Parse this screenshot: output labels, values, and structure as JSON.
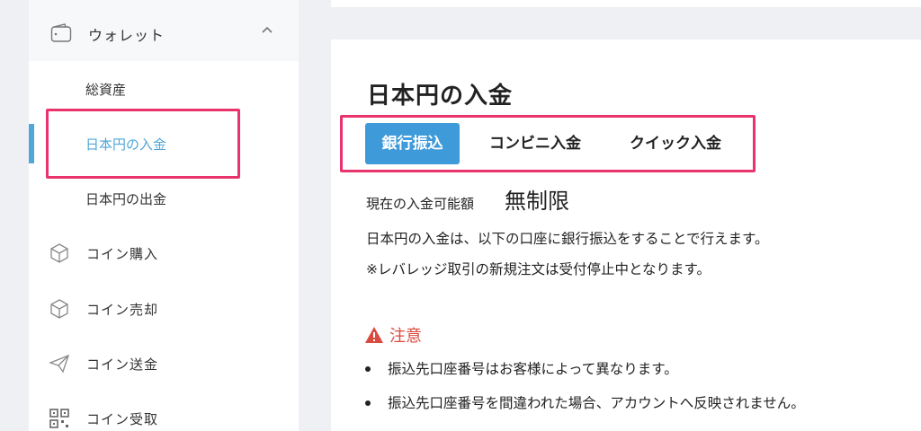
{
  "sidebar": {
    "wallet_label": "ウォレット",
    "sub_items": [
      {
        "label": "総資産"
      },
      {
        "label": "日本円の入金"
      },
      {
        "label": "日本円の出金"
      }
    ],
    "nav_items": [
      {
        "label": "コイン購入",
        "icon": "cube-icon"
      },
      {
        "label": "コイン売却",
        "icon": "cube-icon"
      },
      {
        "label": "コイン送金",
        "icon": "paper-plane-icon"
      },
      {
        "label": "コイン受取",
        "icon": "qr-code-icon"
      }
    ]
  },
  "main": {
    "title": "日本円の入金",
    "tabs": [
      {
        "label": "銀行振込"
      },
      {
        "label": "コンビニ入金"
      },
      {
        "label": "クイック入金"
      }
    ],
    "limit_label": "現在の入金可能額",
    "limit_value": "無制限",
    "line1": "日本円の入金は、以下の口座に銀行振込をすることで行えます。",
    "line2": "※レバレッジ取引の新規注文は受付停止中となります。",
    "warning_title": "注意",
    "bullets": [
      "振込先口座番号はお客様によって異なります。",
      "振込先口座番号を間違われた場合、アカウントへ反映されません。"
    ]
  },
  "colors": {
    "accent": "#3f9ad9",
    "active_text": "#4fa6d9",
    "highlight": "#e8336d",
    "warning": "#d94b3f"
  }
}
